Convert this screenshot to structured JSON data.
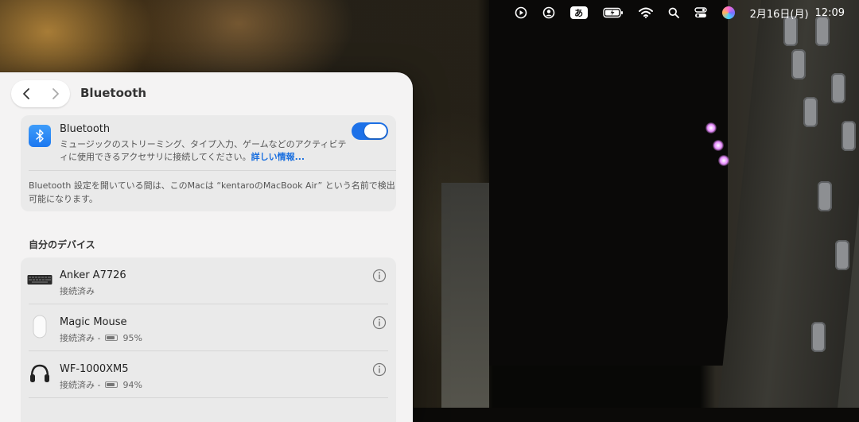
{
  "menubar": {
    "icons": [
      "play-circle-icon",
      "user-circle-icon",
      "ime-icon",
      "battery-charging-icon",
      "wifi-icon",
      "search-icon",
      "control-center-icon",
      "siri-icon"
    ],
    "ime_label": "あ",
    "date": "2月16日(月)",
    "time": "12:09"
  },
  "window": {
    "title": "Bluetooth",
    "bluetooth": {
      "label": "Bluetooth",
      "description": "ミュージックのストリーミング、タイプ入力、ゲームなどのアクティビティに使用できるアクセサリに接続してください。",
      "link": "詳しい情報...",
      "enabled": true,
      "discoverable_note": "Bluetooth 設定を開いている間は、このMacは “kentaroのMacBook Air” という名前で検出可能になります。"
    },
    "devices_section": "自分のデバイス",
    "devices": [
      {
        "name": "Anker A7726",
        "status": "接続済み",
        "battery": "",
        "icon": "keyboard-icon"
      },
      {
        "name": "Magic Mouse",
        "status": "接続済み -",
        "battery": "95%",
        "icon": "mouse-icon"
      },
      {
        "name": "WF-1000XM5",
        "status": "接続済み -",
        "battery": "94%",
        "icon": "headphones-icon"
      }
    ]
  },
  "colors": {
    "accent": "#1d71e8",
    "link": "#1a6fdf",
    "window_bg": "#f4f3f3",
    "card_bg": "#eaeaea"
  }
}
